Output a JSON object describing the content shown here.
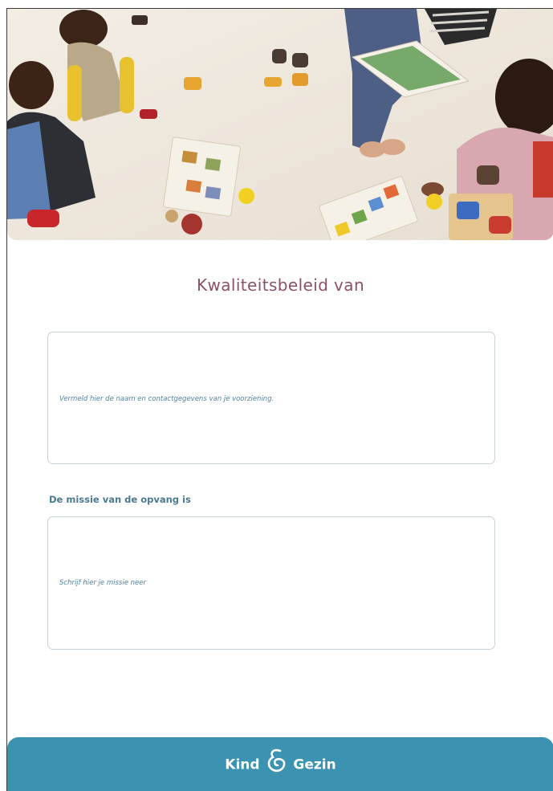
{
  "document": {
    "title": "Kwaliteitsbeleid van"
  },
  "contact_field": {
    "placeholder": "Vermeld hier de naam en contactgegevens van je voorziening."
  },
  "mission": {
    "label": "De missie van de opvang is",
    "placeholder": "Schrijf hier je missie neer"
  },
  "footer": {
    "logo_left": "Kind",
    "logo_right": "Gezin"
  },
  "colors": {
    "title": "#8a4f6a",
    "label": "#4a7990",
    "hint": "#4f84a0",
    "footer": "#3c93b1"
  },
  "icons": {
    "logo_mark": "ampersand-logo-icon"
  }
}
